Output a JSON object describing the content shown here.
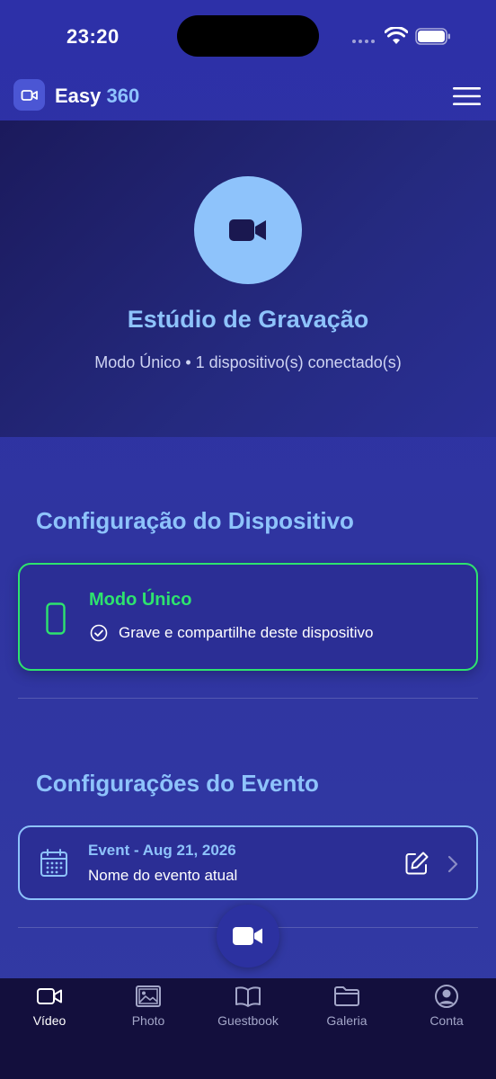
{
  "status_bar": {
    "time": "23:20"
  },
  "header": {
    "app_name_main": "Easy",
    "app_name_accent": "360"
  },
  "hero": {
    "title": "Estúdio de Gravação",
    "subtitle": "Modo Único • 1 dispositivo(s) conectado(s)"
  },
  "device_section": {
    "title": "Configuração do Dispositivo",
    "card_title": "Modo Único",
    "card_description": "Grave e compartilhe deste dispositivo"
  },
  "event_section": {
    "title": "Configurações do Evento",
    "event_name": "Event - Aug 21, 2026",
    "event_description": "Nome do evento atual"
  },
  "tabs": [
    {
      "label": "Vídeo",
      "icon": "video-icon",
      "active": true
    },
    {
      "label": "Photo",
      "icon": "photo-icon",
      "active": false
    },
    {
      "label": "Guestbook",
      "icon": "book-icon",
      "active": false
    },
    {
      "label": "Galeria",
      "icon": "folder-icon",
      "active": false
    },
    {
      "label": "Conta",
      "icon": "account-icon",
      "active": false
    }
  ],
  "colors": {
    "accent_blue": "#8ec3fb",
    "success_green": "#2ee36e",
    "background": "#2f33a3",
    "tab_bar": "#130f3d"
  }
}
